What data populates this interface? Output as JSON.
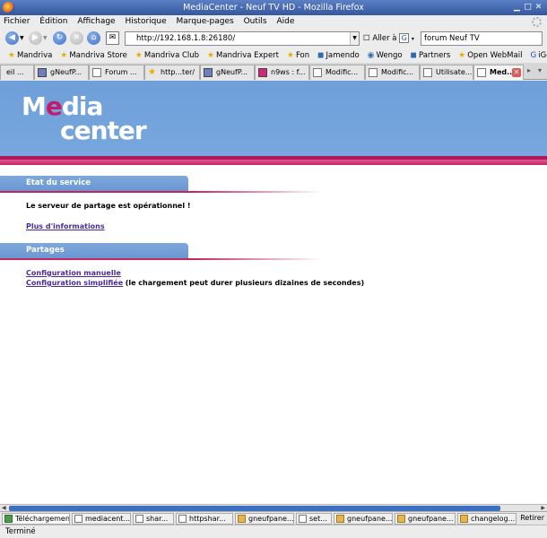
{
  "window": {
    "title": "MediaCenter - Neuf TV HD - Mozilla Firefox"
  },
  "menu": [
    "Fichier",
    "Édition",
    "Affichage",
    "Historique",
    "Marque-pages",
    "Outils",
    "Aide"
  ],
  "nav": {
    "url": "http://192.168.1.8:26180/",
    "go_label": "Aller à",
    "search_value": "forum Neuf TV"
  },
  "bookmarks": [
    "Mandriva",
    "Mandriva Store",
    "Mandriva Club",
    "Mandriva Expert",
    "Fon",
    "Jamendo",
    "Wengo",
    "Partners",
    "Open WebMail",
    "iGoogle"
  ],
  "tabs": [
    {
      "label": "eil ..."
    },
    {
      "label": "gNeufP..."
    },
    {
      "label": "Forum ..."
    },
    {
      "label": "http...ter/"
    },
    {
      "label": "gNeufP..."
    },
    {
      "label": "n9ws : f..."
    },
    {
      "label": "Modific..."
    },
    {
      "label": "Modific..."
    },
    {
      "label": "Utilisate..."
    },
    {
      "label": "Med..."
    }
  ],
  "page": {
    "logo_line1_a": "M",
    "logo_line1_b": "e",
    "logo_line1_c": "dia",
    "logo_line2": "center",
    "section1_title": "Etat du service",
    "status_text": "Le serveur de partage est opérationnel !",
    "more_info_link": "Plus d'informations",
    "section2_title": "Partages",
    "config_manual_link": "Configuration manuelle",
    "config_simple_link": "Configuration simplifiée",
    "config_simple_note": "(le chargement peut durer plusieurs dizaines de secondes)"
  },
  "taskbar": {
    "items": [
      "Téléchargements",
      "mediacent...",
      "shar...",
      "httpshar...",
      "gneufpane...",
      "set...",
      "gneufpane...",
      "gneufpane...",
      "changelog..."
    ],
    "retirer": "Retirer"
  },
  "status": "Terminé"
}
